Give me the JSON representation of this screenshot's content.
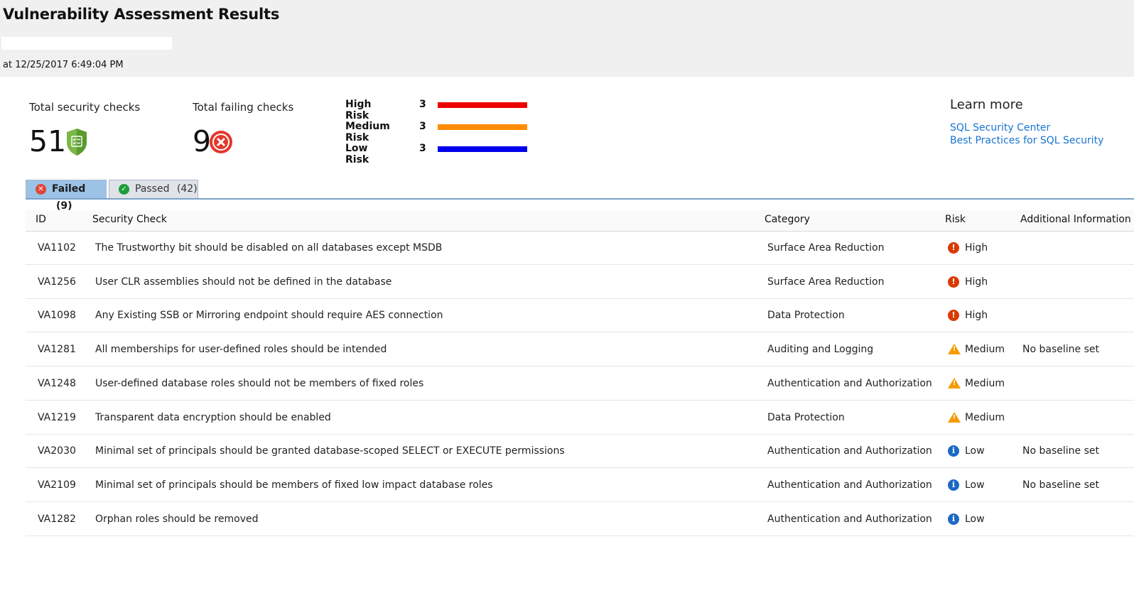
{
  "header": {
    "title": "Vulnerability Assessment Results",
    "timestamp": "at 12/25/2017 6:49:04 PM"
  },
  "summary": {
    "total_checks_label": "Total security checks",
    "total_checks_value": "51",
    "failing_checks_label": "Total failing checks",
    "failing_checks_value": "9"
  },
  "risk_breakdown": [
    {
      "label": "High Risk",
      "count": "3",
      "color": "#ee0000"
    },
    {
      "label": "Medium Risk",
      "count": "3",
      "color": "#ff8c00"
    },
    {
      "label": "Low Risk",
      "count": "3",
      "color": "#0000ee"
    }
  ],
  "learn_more": {
    "title": "Learn more",
    "links": [
      "SQL Security Center",
      "Best Practices for SQL Security"
    ]
  },
  "tabs": [
    {
      "label": "Failed",
      "count": "(9)",
      "icon": "x-circle-icon",
      "color": "#e0453a"
    },
    {
      "label": "Passed",
      "count": "(42)",
      "icon": "check-circle-icon",
      "color": "#1e9e3a"
    }
  ],
  "table": {
    "columns": [
      "ID",
      "Security Check",
      "Category",
      "Risk",
      "Additional Information"
    ],
    "rows": [
      {
        "id": "VA1102",
        "check": "The Trustworthy bit should be disabled on all databases except MSDB",
        "category": "Surface Area Reduction",
        "risk": "High",
        "info": ""
      },
      {
        "id": "VA1256",
        "check": "User CLR assemblies should not be defined in the database",
        "category": "Surface Area Reduction",
        "risk": "High",
        "info": ""
      },
      {
        "id": "VA1098",
        "check": "Any Existing SSB or Mirroring endpoint should require AES connection",
        "category": "Data Protection",
        "risk": "High",
        "info": ""
      },
      {
        "id": "VA1281",
        "check": "All memberships for user-defined roles should be intended",
        "category": "Auditing and Logging",
        "risk": "Medium",
        "info": "No baseline set"
      },
      {
        "id": "VA1248",
        "check": "User-defined database roles should not be members of fixed roles",
        "category": "Authentication and Authorization",
        "risk": "Medium",
        "info": ""
      },
      {
        "id": "VA1219",
        "check": "Transparent data encryption should be enabled",
        "category": "Data Protection",
        "risk": "Medium",
        "info": ""
      },
      {
        "id": "VA2030",
        "check": "Minimal set of principals should be granted database-scoped SELECT or EXECUTE permissions",
        "category": "Authentication and Authorization",
        "risk": "Low",
        "info": "No baseline set"
      },
      {
        "id": "VA2109",
        "check": "Minimal set of principals should be members of fixed low impact database roles",
        "category": "Authentication and Authorization",
        "risk": "Low",
        "info": "No baseline set"
      },
      {
        "id": "VA1282",
        "check": "Orphan roles should be removed",
        "category": "Authentication and Authorization",
        "risk": "Low",
        "info": ""
      }
    ]
  }
}
